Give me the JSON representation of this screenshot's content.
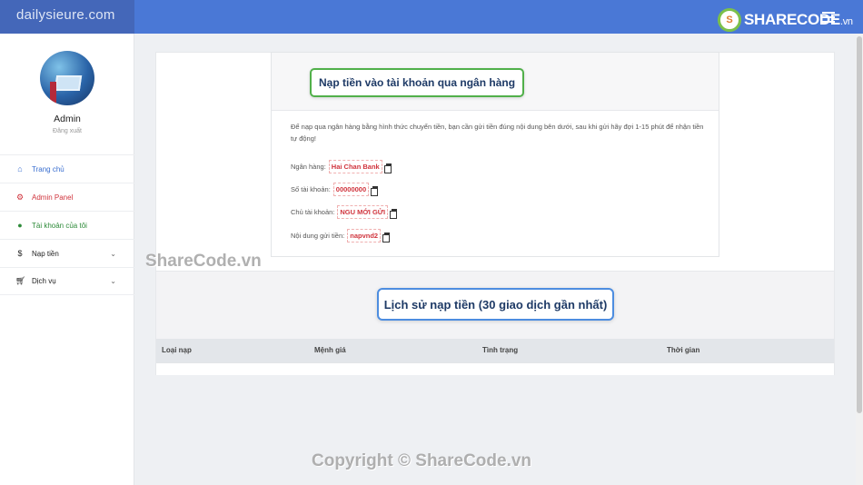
{
  "topbar": {
    "brand": "dailysieure.com",
    "logo_mark": "S",
    "logo_text": "SHARECODE",
    "logo_suffix": ".vn"
  },
  "sidebar": {
    "user_name": "Admin",
    "logout_label": "Đăng xuất",
    "items": [
      {
        "label": "Trang chủ",
        "icon": "home-icon",
        "color": "#3a6fd0"
      },
      {
        "label": "Admin Panel",
        "icon": "gear-icon",
        "color": "#d0343d"
      },
      {
        "label": "Tài khoản của tôi",
        "icon": "user-circle-icon",
        "color": "#2e8b3a"
      },
      {
        "label": "Nạp tiền",
        "icon": "dollar-icon",
        "color": "#222"
      },
      {
        "label": "Dịch vụ",
        "icon": "cart-icon",
        "color": "#222"
      }
    ]
  },
  "deposit": {
    "title": "Nạp tiền vào tài khoản qua ngân hàng",
    "description": "Để nạp qua ngân hàng bằng hình thức chuyển tiền, bạn cần gửi tiền đúng nội dung bên dưới, sau khi gửi hãy đợi 1-15 phút để nhận tiền tự động!",
    "bank_label": "Ngân hàng:",
    "bank_value": "Hai Chan Bank",
    "account_label": "Số tài khoản:",
    "account_value": "00000000",
    "owner_label": "Chủ tài khoản:",
    "owner_value": "NGU MỚI GỬI",
    "content_label": "Nội dung gửi tiền:",
    "content_value": "napvnd2"
  },
  "history": {
    "title": "Lịch sử nạp tiền (30 giao dịch gần nhất)",
    "columns": [
      "Loại nạp",
      "Mệnh giá",
      "Tình trạng",
      "Thời gian"
    ]
  },
  "watermarks": {
    "center": "ShareCode.vn",
    "footer": "Copyright © ShareCode.vn"
  }
}
